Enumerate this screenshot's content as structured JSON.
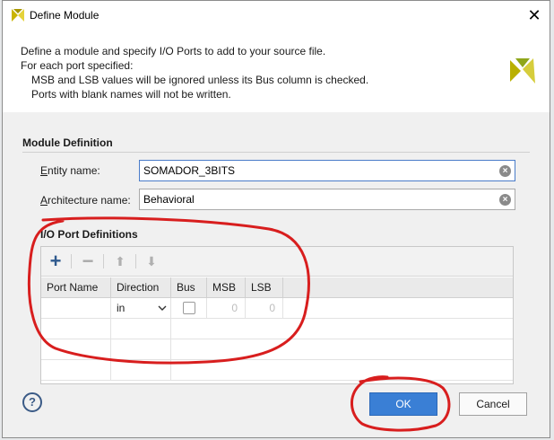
{
  "window": {
    "title": "Define Module",
    "close_glyph": "✕",
    "icon": "xilinx-logo-icon"
  },
  "header": {
    "line1": "Define a module and specify I/O Ports to add to your source file.",
    "line2": "For each port specified:",
    "line3": "MSB and LSB values will be ignored unless its Bus column is checked.",
    "line4": "Ports with blank names will not be written."
  },
  "module_definition": {
    "title": "Module Definition",
    "entity_label_u": "E",
    "entity_label_rest": "ntity name:",
    "entity_value": "SOMADOR_3BITS",
    "arch_label_u": "A",
    "arch_label_rest": "rchitecture name:",
    "arch_value": "Behavioral",
    "clear_glyph": "×"
  },
  "io_ports": {
    "title": "I/O Port Definitions",
    "toolbar": {
      "add": "+",
      "remove": "−",
      "move_up": "⬆",
      "move_down": "⬇"
    },
    "columns": [
      "Port Name",
      "Direction",
      "Bus",
      "MSB",
      "LSB"
    ],
    "rows": [
      {
        "port_name": "",
        "direction": "in",
        "bus": false,
        "msb": "0",
        "lsb": "0"
      }
    ]
  },
  "buttons": {
    "help": "?",
    "ok": "OK",
    "cancel": "Cancel"
  },
  "colors": {
    "accent": "#3a7fd5",
    "annotation": "#d81e1e",
    "add_icon": "#2f5a8e"
  }
}
